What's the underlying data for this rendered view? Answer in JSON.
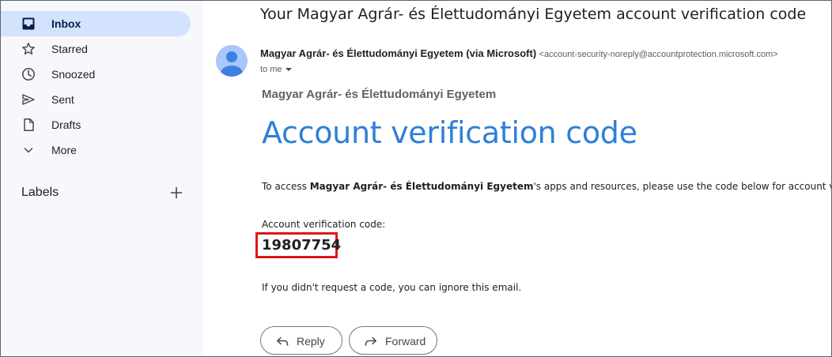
{
  "sidebar": {
    "items": [
      {
        "label": "Inbox",
        "icon": "inbox-icon",
        "active": true
      },
      {
        "label": "Starred",
        "icon": "star-icon"
      },
      {
        "label": "Snoozed",
        "icon": "clock-icon"
      },
      {
        "label": "Sent",
        "icon": "send-icon"
      },
      {
        "label": "Drafts",
        "icon": "draft-icon"
      },
      {
        "label": "More",
        "icon": "chevron-down-icon"
      }
    ],
    "labels_title": "Labels",
    "labels_add_icon": "plus-icon"
  },
  "email": {
    "subject": "Your Magyar Agrár- és Élettudományi Egyetem account verification code",
    "sender_name": "Magyar Agrár- és Élettudományi Egyetem (via Microsoft)",
    "sender_email": "<account-security-noreply@accountprotection.microsoft.com>",
    "to_line": "to me",
    "body": {
      "org_header": "Magyar Agrár- és Élettudományi Egyetem",
      "title": "Account verification code",
      "access_prefix": "To access ",
      "access_org": "Magyar Agrár- és Élettudományi Egyetem",
      "access_suffix": "'s apps and resources, please use the code below for account verification.",
      "code_label": "Account verification code:",
      "code": "19807754",
      "ignore_text": "If you didn't request a code, you can ignore this email."
    }
  },
  "actions": {
    "reply_label": "Reply",
    "forward_label": "Forward"
  },
  "colors": {
    "sidebar_bg": "#f6f8fc",
    "active_item_bg": "#d3e3fd",
    "title_blue": "#2f7fd8",
    "highlight_red": "#e2151b",
    "avatar_bg": "#a8c7fa"
  }
}
